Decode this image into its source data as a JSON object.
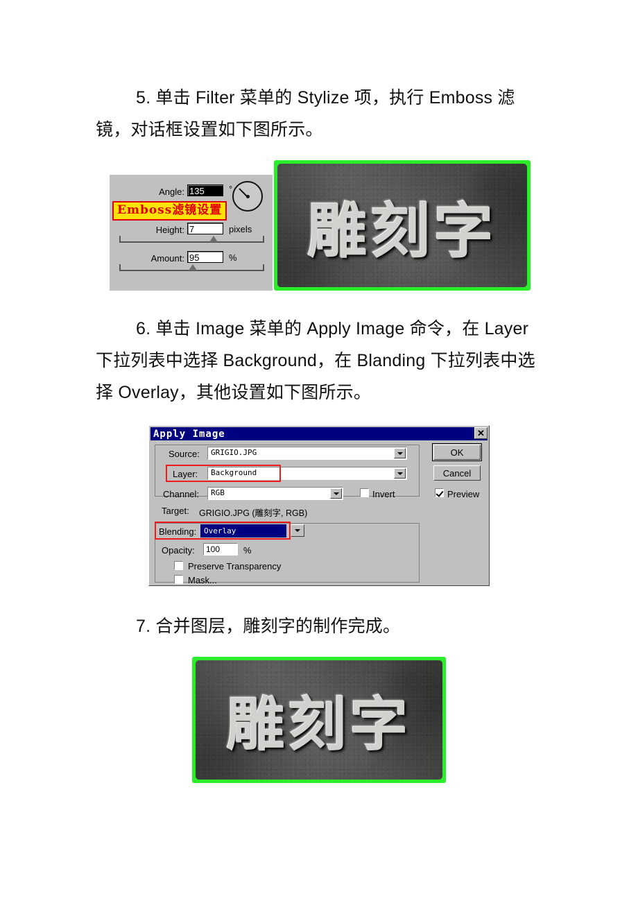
{
  "document": {
    "paragraphs": [
      {
        "id": "step5",
        "text": "5. 单击 Filter 菜单的 Stylize 项，执行 Emboss 滤镜，对话框设置如下图所示。"
      },
      {
        "id": "step6",
        "text": "6. 单击 Image 菜单的 Apply Image 命令，在 Layer 下拉列表中选择 Background，在 Blanding 下拉列表中选择 Overlay，其他设置如下图所示。"
      },
      {
        "id": "step7",
        "text": "7. 合并图层，雕刻字的制作完成。"
      }
    ]
  },
  "emboss_dialog": {
    "annotation": "Emboss滤镜设置",
    "annotation_text_color": "#e00000",
    "annotation_bg_color": "#ffe300",
    "fields": {
      "angle_label": "Angle:",
      "angle_value": "135",
      "angle_unit": "°",
      "height_label": "Height:",
      "height_value": "7",
      "height_unit": "pixels",
      "amount_label": "Amount:",
      "amount_value": "95",
      "amount_unit": "%"
    }
  },
  "emboss_preview_image": {
    "caption": "雕刻字",
    "characters": "雕刻字",
    "border_color": "#2bee2b",
    "stone_color": "#535754"
  },
  "apply_image_dialog": {
    "title": "Apply Image",
    "close_icon": "✕",
    "source_label": "Source:",
    "source_value": "GRIGIO.JPG",
    "layer_label": "Layer:",
    "layer_value": "Background",
    "channel_label": "Channel:",
    "channel_value": "RGB",
    "invert_label": "Invert",
    "invert_checked": false,
    "target_label": "Target:",
    "target_value": "GRIGIO.JPG (雕刻字, RGB)",
    "blending_label": "Blending:",
    "blending_value": "Overlay",
    "opacity_label": "Opacity:",
    "opacity_value": "100",
    "opacity_unit": "%",
    "preserve_transparency_label": "Preserve Transparency",
    "preserve_transparency_checked": false,
    "mask_label": "Mask...",
    "mask_checked": false,
    "ok_label": "OK",
    "cancel_label": "Cancel",
    "preview_label": "Preview",
    "preview_checked": true,
    "highlight_color": "#000080",
    "annotation_box_color": "#ee1c1c"
  },
  "final_image": {
    "characters": "雕刻字",
    "border_color": "#2bee2b",
    "stone_color": "#535754"
  }
}
